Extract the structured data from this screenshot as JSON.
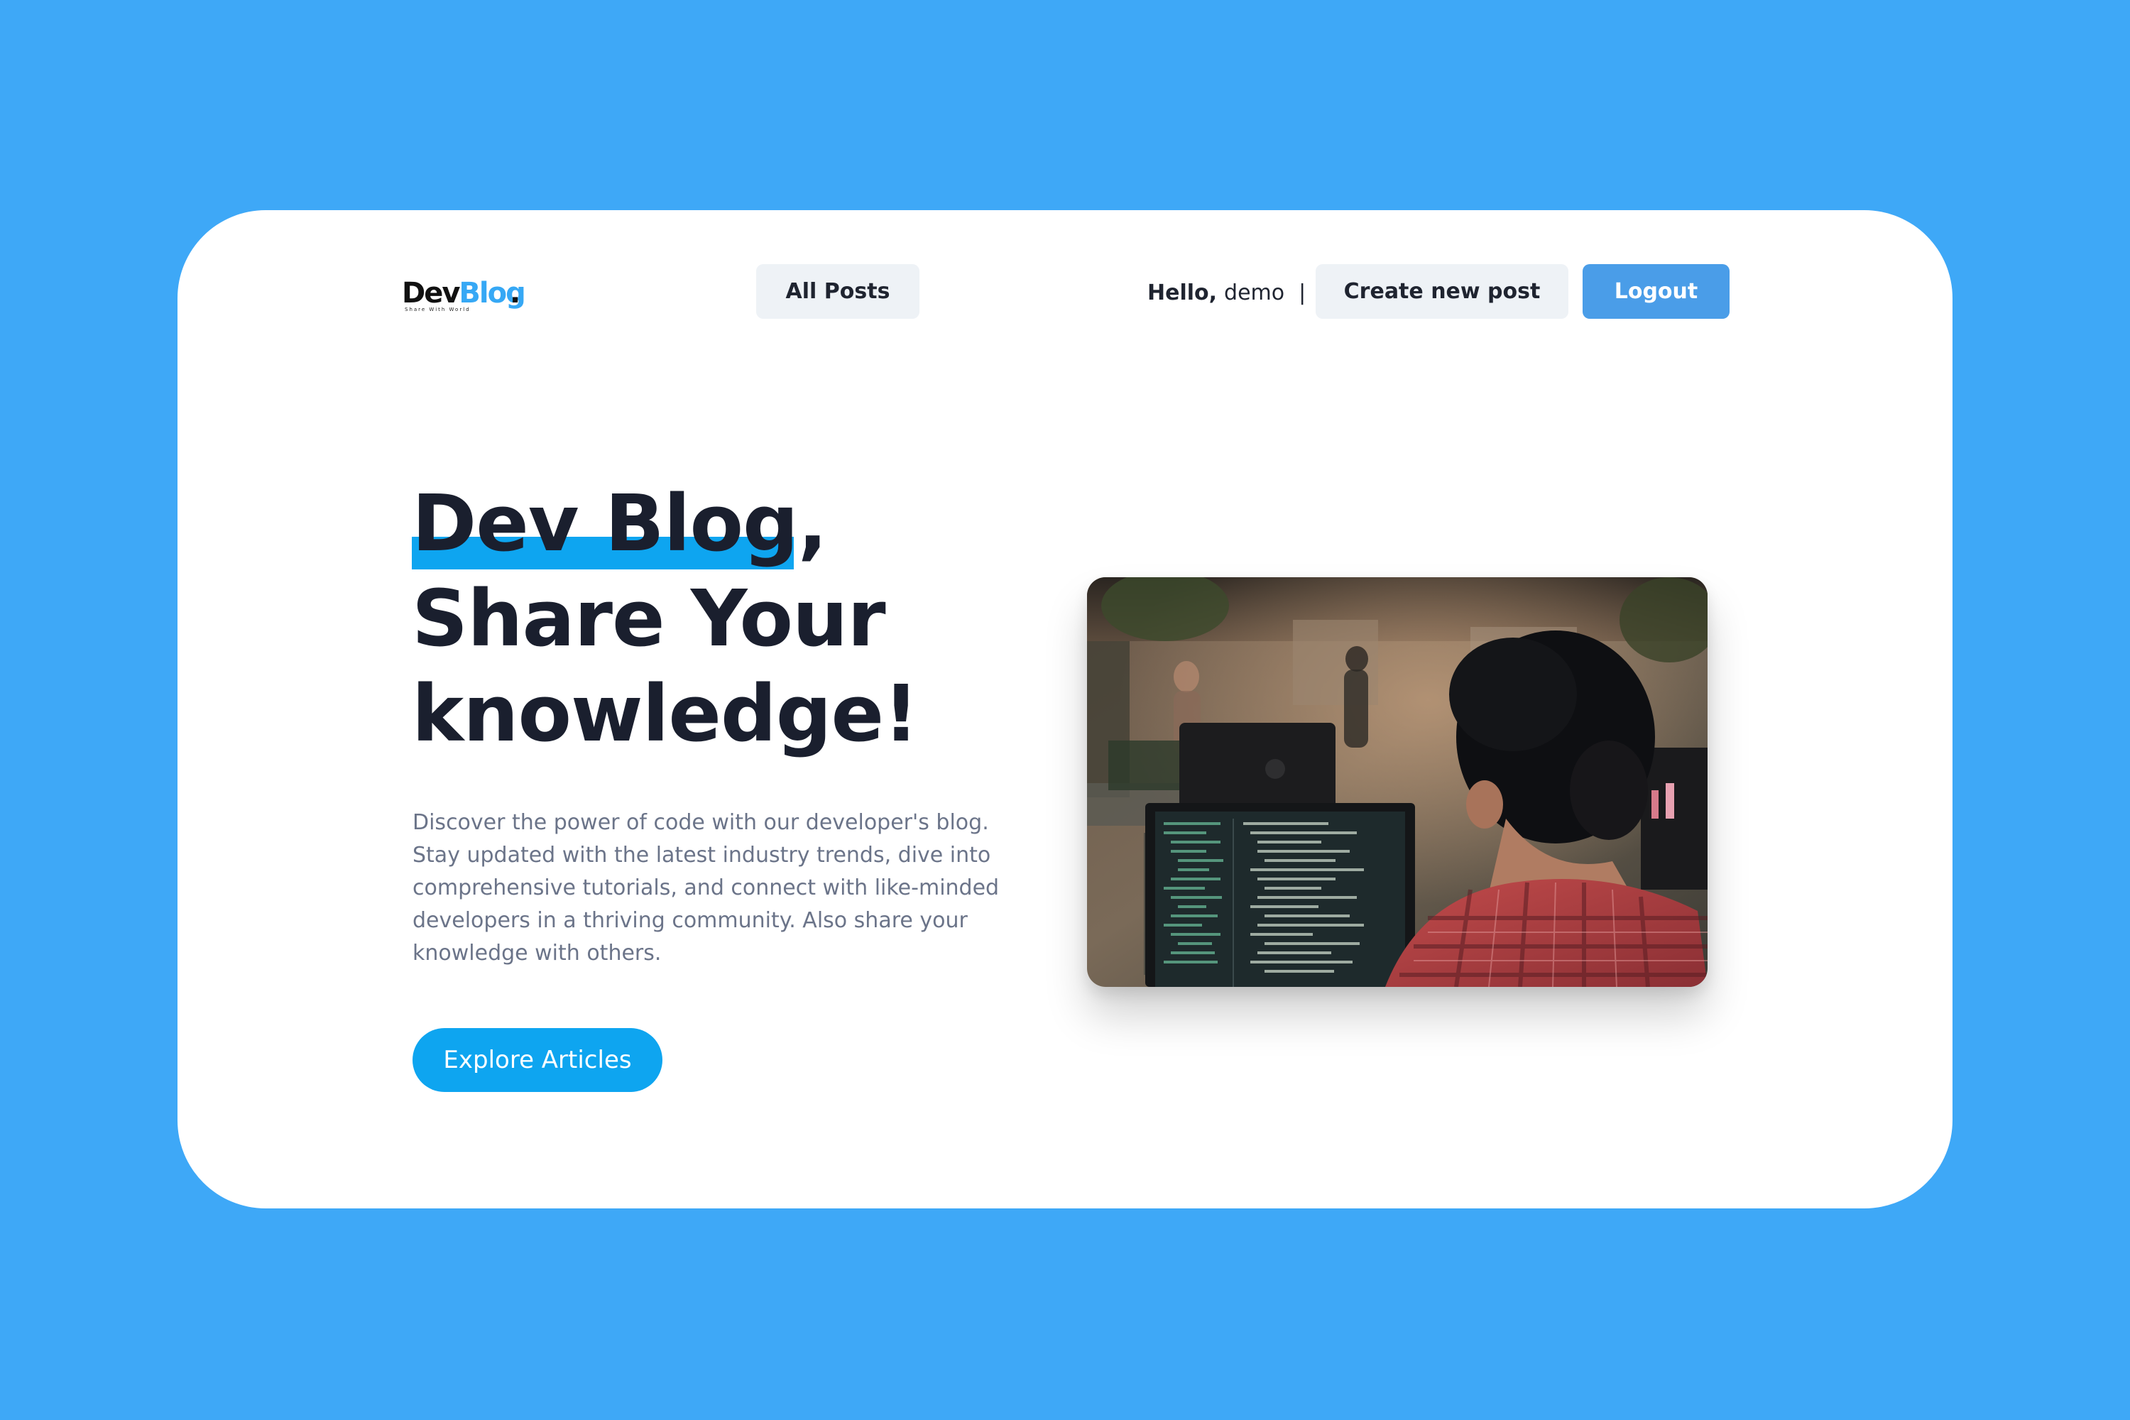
{
  "brand": {
    "logo_dev": "Dev",
    "logo_blog": "Blog",
    "logo_dot": ".",
    "tagline": "Share With World"
  },
  "nav": {
    "all_posts": "All Posts",
    "greeting": "Hello,",
    "username": "demo",
    "separator": "|",
    "create_post": "Create new post",
    "logout": "Logout"
  },
  "hero": {
    "title_line1": "Dev Blog,",
    "title_line2": "Share Your",
    "title_line3": "knowledge!",
    "description": "Discover the power of code with our developer's blog. Stay updated with the latest industry trends, dive into comprehensive tutorials, and connect with like-minded developers in a thriving community. Also share your knowledge with others.",
    "cta": "Explore Articles",
    "photo_icon": "developer-coding-photo"
  },
  "colors": {
    "page_background": "#3ea8f7",
    "accent": "#0ea5f0",
    "logout_button": "#4a9de8",
    "nav_button_bg": "#eef2f6",
    "heading": "#1a1f2e",
    "body_text": "#6b7489"
  }
}
